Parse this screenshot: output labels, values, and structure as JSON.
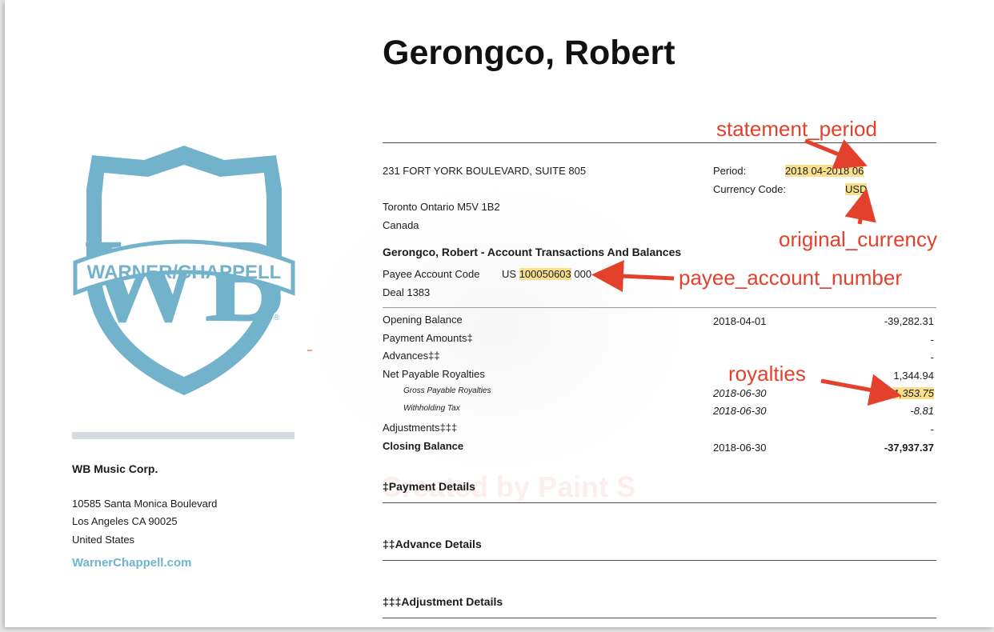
{
  "header": {
    "name": "Gerongco, Robert"
  },
  "payee": {
    "address_line1": "231 FORT YORK BOULEVARD, SUITE 805",
    "address_line2": "Toronto Ontario M5V 1B2",
    "address_line3": "Canada"
  },
  "period": {
    "period_label": "Period:",
    "period_value": "2018 04-2018 06",
    "currency_label": "Currency Code:",
    "currency_value": "USD"
  },
  "account": {
    "heading": "Gerongco, Robert - Account Transactions And Balances",
    "payee_code_label": "Payee Account Code",
    "payee_code_prefix": "US",
    "payee_code_number": "100050603",
    "payee_code_suffix": "000",
    "deal": "Deal 1383"
  },
  "transactions": [
    {
      "label": "Opening Balance",
      "date": "2018-04-01",
      "amount": "-39,282.31"
    },
    {
      "label": "Payment Amounts‡",
      "date": "",
      "amount": "-"
    },
    {
      "label": "Advances‡‡",
      "date": "",
      "amount": "-"
    },
    {
      "label": "Net Payable Royalties",
      "date": "",
      "amount": "1,344.94"
    },
    {
      "label": "Gross Payable Royalties",
      "date": "2018-06-30",
      "amount": "1,353.75"
    },
    {
      "label": "Withholding Tax",
      "date": "2018-06-30",
      "amount": "-8.81"
    },
    {
      "label": "Adjustments‡‡‡",
      "date": "",
      "amount": "-"
    },
    {
      "label": "Closing Balance",
      "date": "2018-06-30",
      "amount": "-37,937.37"
    }
  ],
  "sections": {
    "payment": "‡Payment Details",
    "advance": "‡‡Advance Details",
    "adjustment": "‡‡‡Adjustment Details"
  },
  "company": {
    "name": "WB Music Corp.",
    "address1": "10585 Santa Monica Boulevard",
    "address2": "Los Angeles CA 90025",
    "address3": "United States",
    "website": "WarnerChappell.com",
    "logo_text": "WARNER/CHAPPELL",
    "logo_letters": "WB"
  },
  "annotations": {
    "statement_period": "statement_period",
    "original_currency": "original_currency",
    "payee_account_number": "payee_account_number",
    "royalties": "royalties"
  },
  "watermark": "Created by Paint S",
  "colors": {
    "annotation_red": "#e3412b",
    "highlight": "#f7df8c",
    "logo_blue": "#72b3cb"
  }
}
